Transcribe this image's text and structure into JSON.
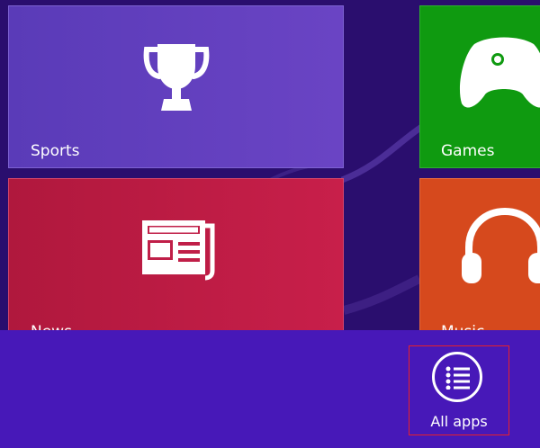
{
  "tiles": {
    "sports": {
      "label": "Sports",
      "icon": "trophy-icon",
      "color": "#6244c0"
    },
    "games": {
      "label": "Games",
      "icon": "game-controller-icon",
      "color": "#0f9a10"
    },
    "news": {
      "label": "News",
      "icon": "newspaper-icon",
      "color": "#c01f48"
    },
    "music": {
      "label": "Music",
      "icon": "headphones-icon",
      "color": "#d6491d"
    }
  },
  "app_bar": {
    "color": "#4718b8",
    "all_apps": {
      "label": "All apps",
      "icon": "list-icon",
      "highlight_color": "#e8202a"
    }
  },
  "background": {
    "color": "#2a0e6e"
  }
}
